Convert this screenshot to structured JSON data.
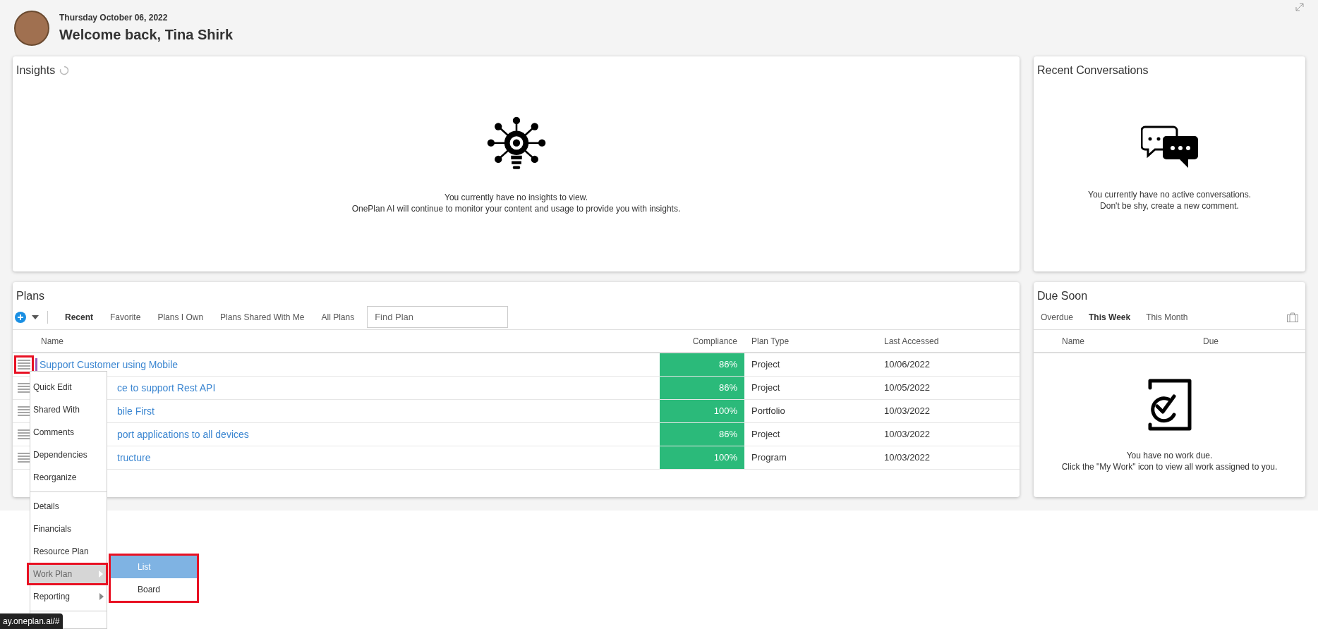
{
  "header": {
    "date": "Thursday October 06, 2022",
    "greeting": "Welcome back, Tina Shirk"
  },
  "insights": {
    "title": "Insights",
    "empty_lines": [
      "You currently have no insights to view.",
      "OnePlan AI will continue to monitor your content and usage to provide you with insights."
    ]
  },
  "conversations": {
    "title": "Recent Conversations",
    "empty_lines": [
      "You currently have no active conversations.",
      "Don't be shy, create a new comment."
    ]
  },
  "plans": {
    "title": "Plans",
    "filters": [
      {
        "label": "Recent",
        "selected": true
      },
      {
        "label": "Favorite",
        "selected": false
      },
      {
        "label": "Plans I Own",
        "selected": false
      },
      {
        "label": "Plans Shared With Me",
        "selected": false
      },
      {
        "label": "All Plans",
        "selected": false
      }
    ],
    "search": {
      "placeholder": "Find Plan"
    },
    "columns": [
      "Name",
      "Compliance",
      "Plan Type",
      "Last Accessed"
    ],
    "rows": [
      {
        "name": "Support Customer using Mobile",
        "menu_open": true,
        "color": "#9b59b6",
        "compliance": "86%",
        "type": "Project",
        "accessed": "10/06/2022"
      },
      {
        "name": "ce to support Rest API",
        "menu_open": false,
        "compliance": "86%",
        "type": "Project",
        "accessed": "10/05/2022"
      },
      {
        "name": "bile First",
        "menu_open": false,
        "compliance": "100%",
        "type": "Portfolio",
        "accessed": "10/03/2022"
      },
      {
        "name": "port applications to all devices",
        "menu_open": false,
        "compliance": "86%",
        "type": "Project",
        "accessed": "10/03/2022"
      },
      {
        "name": "tructure",
        "menu_open": false,
        "compliance": "100%",
        "type": "Program",
        "accessed": "10/03/2022"
      }
    ]
  },
  "due_soon": {
    "title": "Due Soon",
    "tabs": [
      {
        "label": "Overdue",
        "selected": false
      },
      {
        "label": "This Week",
        "selected": true
      },
      {
        "label": "This Month",
        "selected": false
      }
    ],
    "columns": [
      "Name",
      "Due"
    ],
    "empty_lines": [
      "You have no work due.",
      "Click the \"My Work\" icon to view all work assigned to you."
    ]
  },
  "context_menu": {
    "groups": [
      [
        {
          "label": "Quick Edit",
          "submenu": false,
          "selected": false
        },
        {
          "label": "Shared With",
          "submenu": false,
          "selected": false
        },
        {
          "label": "Comments",
          "submenu": false,
          "selected": false
        },
        {
          "label": "Dependencies",
          "submenu": false,
          "selected": false
        },
        {
          "label": "Reorganize",
          "submenu": false,
          "selected": false
        }
      ],
      [
        {
          "label": "Details",
          "submenu": false,
          "selected": false
        },
        {
          "label": "Financials",
          "submenu": false,
          "selected": false
        },
        {
          "label": "Resource Plan",
          "submenu": false,
          "selected": false
        },
        {
          "label": "Work Plan",
          "submenu": true,
          "selected": true
        },
        {
          "label": "Reporting",
          "submenu": true,
          "selected": false
        }
      ]
    ],
    "submenu": [
      {
        "label": "List",
        "selected": true
      },
      {
        "label": "Board",
        "selected": false
      }
    ]
  },
  "status_tooltip": "ay.oneplan.ai/#"
}
